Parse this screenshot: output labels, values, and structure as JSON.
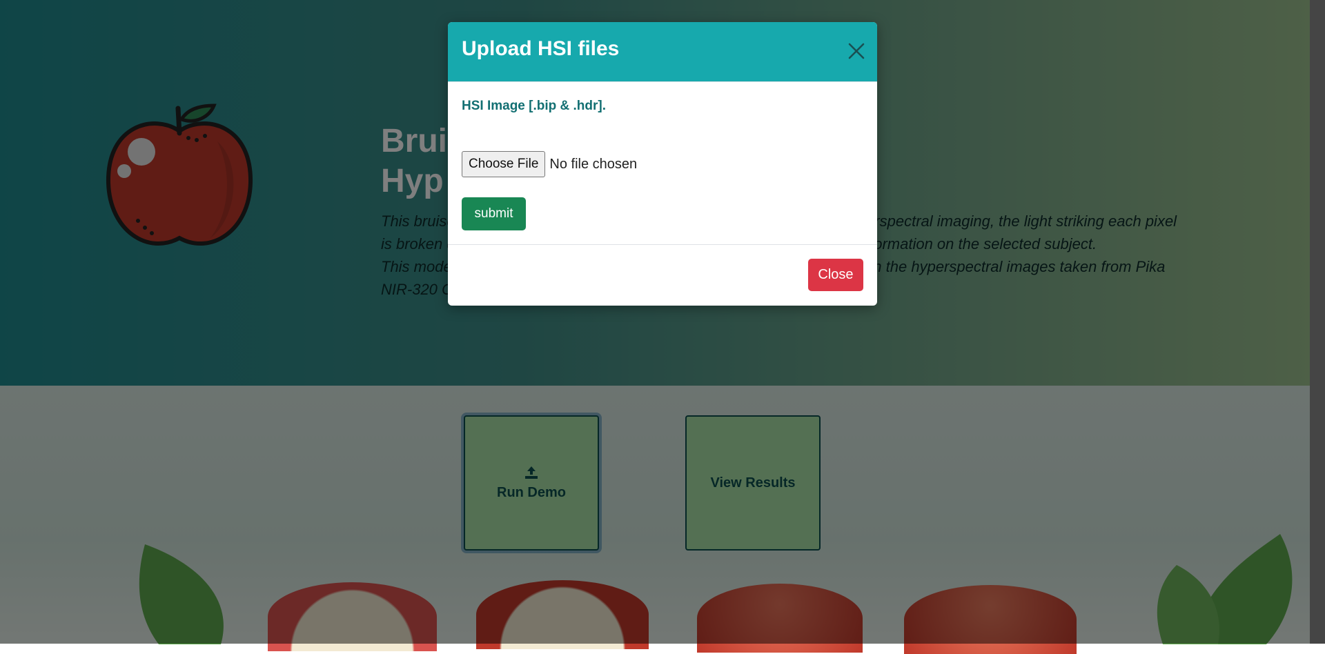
{
  "page": {
    "hero_title_line1": "Bruis",
    "hero_title_line2": "Hyp",
    "hero_desc_1a": "This bruise",
    "hero_desc_1b": "hyperspectral imaging, the light striking each pixel",
    "hero_desc_2a": "is broken d",
    "hero_desc_2b": "e information on the selected subject.",
    "hero_desc_3a": "This mode",
    "hero_desc_3b": "d on the hyperspectral images taken from Pika",
    "hero_desc_4a": "NIR-320 C"
  },
  "actions": {
    "run_demo_label": "Run Demo",
    "view_results_label": "View Results"
  },
  "modal": {
    "title": "Upload HSI files",
    "field_label": "HSI Image [.bip & .hdr].",
    "choose_file_label": "Choose File",
    "file_status": "No file chosen",
    "submit_label": "submit",
    "close_label": "Close"
  },
  "colors": {
    "modal_header": "#17a9ad",
    "submit": "#198754",
    "close": "#dc3545"
  },
  "icons": {
    "logo": "apple-icon",
    "upload": "upload-icon",
    "dismiss": "close-icon"
  }
}
